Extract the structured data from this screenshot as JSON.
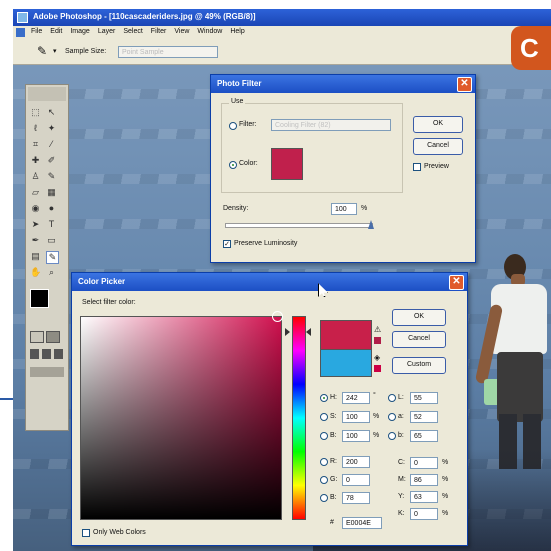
{
  "app": {
    "title": "Adobe Photoshop - [110cascaderiders.jpg @ 49% (RGB/8)]",
    "menu": [
      "File",
      "Edit",
      "Image",
      "Layer",
      "Select",
      "Filter",
      "View",
      "Window",
      "Help"
    ],
    "options_bar": {
      "sample_size_label": "Sample Size:",
      "sample_size_value": "Point Sample"
    }
  },
  "badge": {
    "letter": "C"
  },
  "photo_filter": {
    "title": "Photo Filter",
    "use_label": "Use",
    "filter_option": "Filter:",
    "filter_value": "Cooling Filter (82)",
    "color_option": "Color:",
    "density_label": "Density:",
    "density_value": "100",
    "density_unit": "%",
    "density_level": 1.0,
    "preserve_label": "Preserve Luminosity",
    "ok": "OK",
    "cancel": "Cancel",
    "preview": "Preview",
    "swatch_color": "#c0204c"
  },
  "color_picker": {
    "title": "Color Picker",
    "prompt": "Select filter color:",
    "ok": "OK",
    "cancel": "Cancel",
    "custom": "Custom",
    "only_web": "Only Web Colors",
    "new_color": "#c8204a",
    "old_color": "#29a8e0",
    "hsb": [
      {
        "label": "H:",
        "value": "242",
        "unit": "°"
      },
      {
        "label": "S:",
        "value": "100",
        "unit": "%"
      },
      {
        "label": "B:",
        "value": "100",
        "unit": "%"
      }
    ],
    "rgb": [
      {
        "label": "R:",
        "value": "200",
        "unit": ""
      },
      {
        "label": "G:",
        "value": "0",
        "unit": ""
      },
      {
        "label": "B:",
        "value": "78",
        "unit": ""
      }
    ],
    "lab": [
      {
        "label": "L:",
        "value": "55",
        "unit": ""
      },
      {
        "label": "a:",
        "value": "52",
        "unit": ""
      },
      {
        "label": "b:",
        "value": "65",
        "unit": ""
      }
    ],
    "cmyk": [
      {
        "label": "C:",
        "value": "0",
        "unit": "%"
      },
      {
        "label": "M:",
        "value": "86",
        "unit": "%"
      },
      {
        "label": "Y:",
        "value": "63",
        "unit": "%"
      },
      {
        "label": "K:",
        "value": "0",
        "unit": "%"
      }
    ],
    "hex_label": "#",
    "hex_value": "E0004E",
    "hue_base": "#d0104e"
  }
}
